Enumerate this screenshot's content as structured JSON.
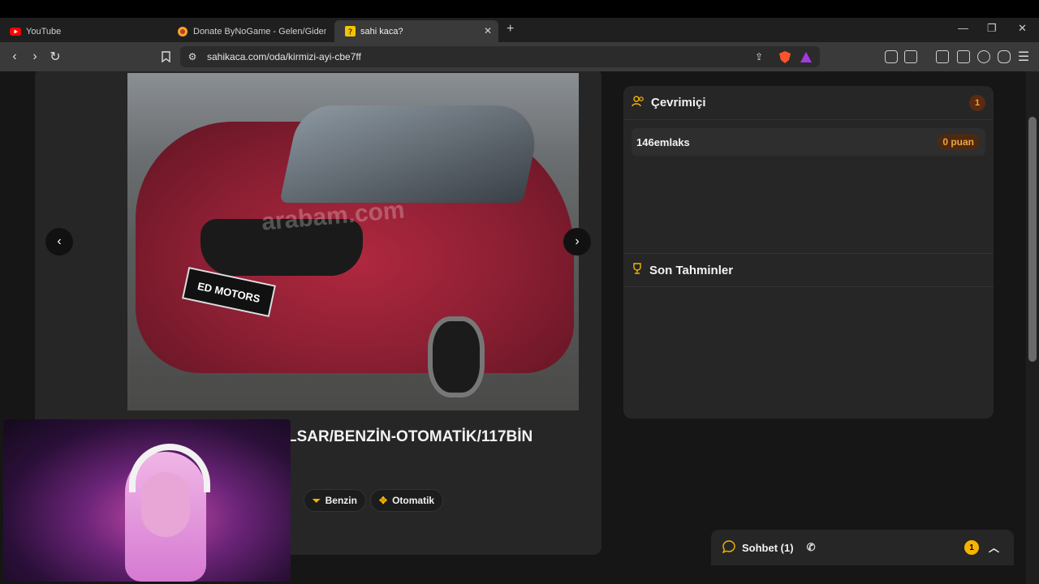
{
  "browser": {
    "tabs": [
      {
        "label": "YouTube",
        "icon": "youtube-icon"
      },
      {
        "label": "Donate ByNoGame - Gelen/Giden Ba",
        "icon": "bynogame-icon"
      },
      {
        "label": "sahi kaca?",
        "icon": "question-icon"
      }
    ],
    "new_tab": "+",
    "url": "sahikaca.com/oda/kirmizi-ayi-cbe7ff"
  },
  "listing": {
    "title": "LSAR/BENZİN-OTOMATİK/117BİN",
    "photo_watermark": "arabam.com",
    "plate_text": "ED MOTORS",
    "chips": [
      {
        "label": "Benzin",
        "icon": "filter-icon"
      },
      {
        "label": "Otomatik",
        "icon": "gear-shift-icon"
      }
    ]
  },
  "online": {
    "title": "Çevrimiçi",
    "count": "1",
    "users": [
      {
        "name": "146emlaks",
        "score": "0 puan"
      }
    ]
  },
  "guesses": {
    "title": "Son Tahminler"
  },
  "chat": {
    "label": "Sohbet (1)",
    "badge": "1"
  },
  "colors": {
    "accent": "#f5b400",
    "card": "#262626",
    "page": "#161616"
  }
}
